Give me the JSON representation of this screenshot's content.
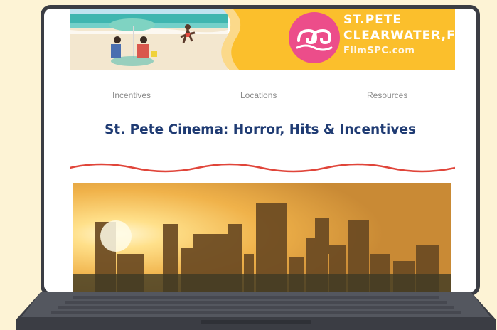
{
  "banner": {
    "line1": "ST.PETE",
    "line2": "CLEARWATER,FL",
    "line3": "FilmSPC.com",
    "colors": {
      "yellow": "#fbbf2c",
      "pink": "#ec4d8a",
      "sea": "#45b9b5",
      "sand": "#f3e7cf"
    }
  },
  "nav": {
    "items": [
      "Incentives",
      "Locations",
      "Resources"
    ]
  },
  "page": {
    "title": "St. Pete Cinema: Horror, Hits & Incentives",
    "title_color": "#1f3b73",
    "wave_color": "#e0453a"
  },
  "hero": {
    "description": "sunset skyline photo"
  },
  "device": {
    "frame_color": "#3b3d44",
    "background": "#fdf3d5"
  }
}
